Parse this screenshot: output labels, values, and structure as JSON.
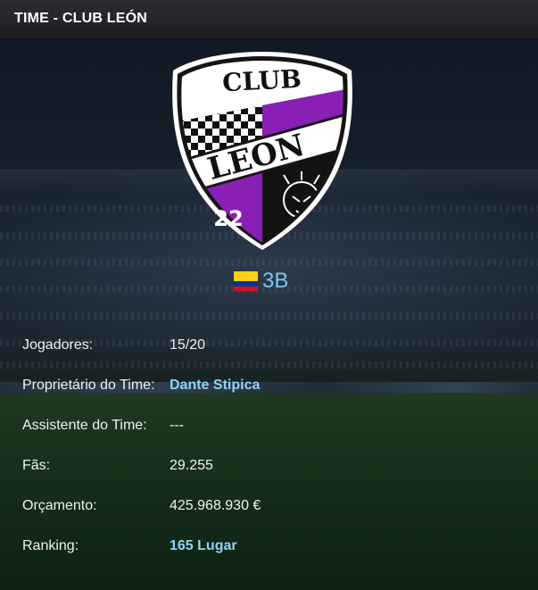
{
  "header": {
    "title": "TIME - CLUB LEÓN"
  },
  "crest": {
    "text_top": "CLUB",
    "text_band": "LEON",
    "number": "22"
  },
  "division": {
    "label": "3B",
    "flag_colors": [
      "#FCD116",
      "#003893",
      "#CE1126"
    ]
  },
  "info": {
    "rows": [
      {
        "label": "Jogadores:",
        "value": "15/20",
        "is_link": false
      },
      {
        "label": "Proprietário do Time:",
        "value": "Dante Stipica",
        "is_link": true
      },
      {
        "label": "Assistente do Time:",
        "value": "---",
        "is_link": false
      },
      {
        "label": "Fãs:",
        "value": "29.255",
        "is_link": false
      },
      {
        "label": "Orçamento:",
        "value": "425.968.930 €",
        "is_link": false
      },
      {
        "label": "Ranking:",
        "value": "165 Lugar",
        "is_link": true
      }
    ]
  },
  "colors": {
    "accent_link": "#8fd3f4",
    "division_text": "#7ec9ec",
    "crest_purple": "#8a1fb5"
  }
}
